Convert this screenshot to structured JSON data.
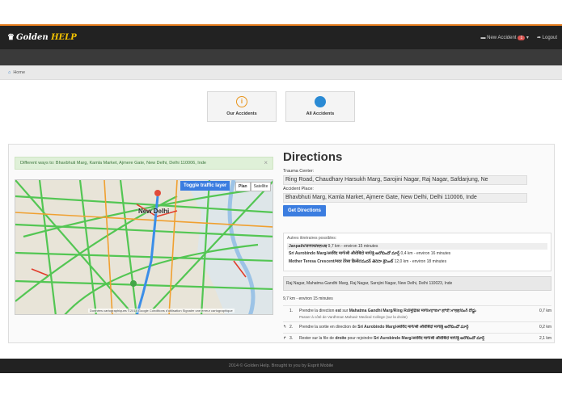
{
  "brand": {
    "prefix": "Golden ",
    "highlight": "HELP"
  },
  "nav": {
    "accident_label": "New Accident",
    "accident_count": "1",
    "logout_label": "Logout"
  },
  "breadcrumb": {
    "home": "Home"
  },
  "tiles": [
    {
      "label": "Our Accidents",
      "icon": "info-icon",
      "color": "#e8941a"
    },
    {
      "label": "All Accidents",
      "icon": "globe-icon",
      "color": "#2a8ad4"
    }
  ],
  "alert": {
    "text": "Different ways to: Bhavbhuti Marg, Kamla Market, Ajmere Gate, New Delhi, Delhi 110006, Inde",
    "close": "×"
  },
  "map": {
    "toggle_label": "Toggle traffic layer",
    "type_plan": "Plan",
    "type_satellite": "Satellite",
    "city_label": "New Delhi",
    "attribution": "Données cartographiques ©2014 Google   Conditions d'utilisation   Signaler une erreur cartographique"
  },
  "directions": {
    "title": "Directions",
    "trauma_label": "Trauma Center:",
    "trauma_value": "Ring Road, Chaudhary Harsukh Marg, Sarojini Nagar, Raj Nagar, Safdarjung, Ne",
    "accident_label": "Accident Place:",
    "accident_value": "Bhavbhuti Marg, Kamla Market, Ajmere Gate, New Delhi, Delhi 110006, Inde",
    "button": "Get Directions"
  },
  "alternatives": {
    "title": "Autres itinéraires possibles:",
    "routes": [
      {
        "name": "Janpath/जनपथ/ਜਨਪਥ",
        "info": " 9,7 km - environ 15 minutes"
      },
      {
        "name": "Sri Aurobindo Marg/अरविंद मार्ग/श्री औरोबिंदो मार्ग/శ్రీ అరోబిందో మార్గ్",
        "info": " 0,4 km - environ 16 minutes"
      },
      {
        "name": "Mother Teresa Crescent/मदर टेरेसा क्रिसेंट/మదర్ తెరెసా క్రెసెంట్",
        "info": " 12,0 km - environ 18 minutes"
      }
    ]
  },
  "address": "Raj Nagar, Mahatma Gandhi Marg, Raj Nagar, Sarojini Nagar, New Delhi, Delhi 110023, Inde",
  "summary": "9,7 km - environ 15 minutes",
  "steps": [
    {
      "n": "1.",
      "pre": "Prendre la direction ",
      "bold1": "est",
      "mid": " sur ",
      "bold2": "Mahatma Gandhi Marg/Ring Rd/",
      "tail": "मुद्रिका मार्ग/ਮਹਾਤਮਾ ਗਾਂਧੀ ਮਾਰਗ/రింగ్ రోడ్డు",
      "sub": "Passer à côté de Vardhman Mahavir Medical College (sur la droite)",
      "dist": "0,7 km",
      "icon": ""
    },
    {
      "n": "2.",
      "pre": "Prendre la sortie en direction de ",
      "bold1": "",
      "mid": "",
      "bold2": "Sri Aurobindo Marg/",
      "tail": "अरविंद मार्ग/श्री औरोबिंदो मार्ग/శ్రీ అరోబిందో మార్గ్",
      "sub": "",
      "dist": "0,2 km",
      "icon": "↰"
    },
    {
      "n": "3.",
      "pre": "Rester sur la file de ",
      "bold1": "droite",
      "mid": " pour rejoindre ",
      "bold2": "Sri Aurobindo Marg/",
      "tail": "अरविंद मार्ग/श्री औरोबिंदो मार्ग/శ్రీ అరోబిందో మార్గ్",
      "sub": "",
      "dist": "2,1 km",
      "icon": "↱"
    }
  ],
  "footer": "2014 © Golden Help. Brought to you by Esprit Mobile"
}
